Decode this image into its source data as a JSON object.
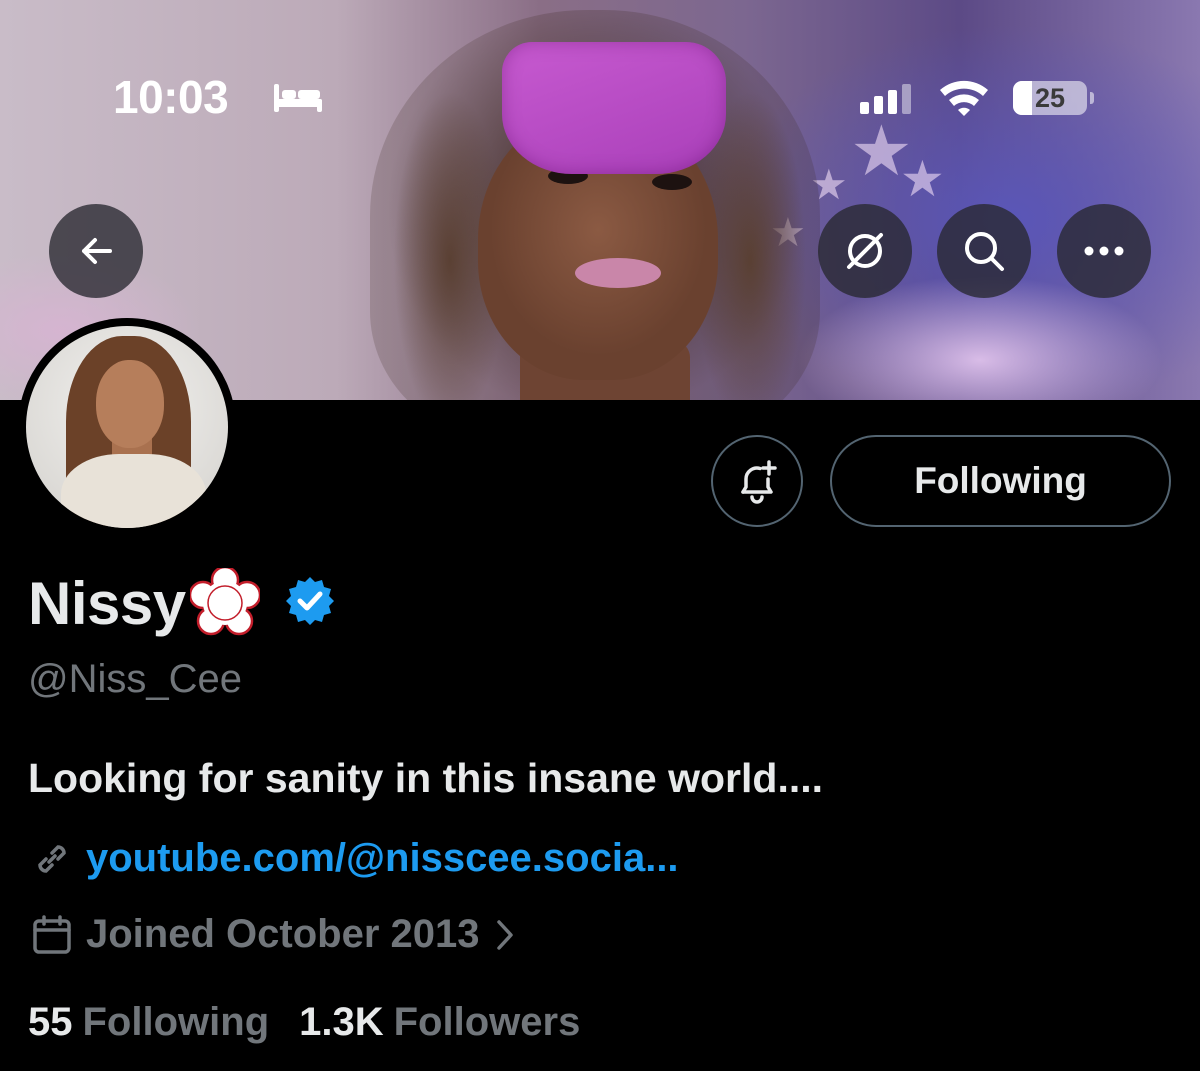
{
  "status_bar": {
    "time": "10:03",
    "focus_mode_icon": "bed-icon",
    "battery_level": "25",
    "battery_fraction": 0.25
  },
  "nav": {
    "back_icon": "arrow-left-icon",
    "grok_icon": "grok-icon",
    "search_icon": "search-icon",
    "more_icon": "more-horizontal-icon"
  },
  "actions": {
    "notify_icon": "bell-plus-icon",
    "following_label": "Following"
  },
  "profile": {
    "display_name": "Nissy",
    "stamp_text": "大変よくできました。",
    "verified": true,
    "handle": "@Niss_Cee",
    "bio": "Looking for sanity in this insane world....",
    "link": "youtube.com/@nisscee.socia...",
    "joined": "Joined October 2013",
    "following_count": "55",
    "following_label": "Following",
    "followers_count": "1.3K",
    "followers_label": "Followers"
  },
  "colors": {
    "background": "#000000",
    "text_primary": "#e7e9ea",
    "text_secondary": "#71767b",
    "link": "#1d9bf0",
    "verified": "#1d9bf0",
    "mask": "#c75ad0"
  }
}
